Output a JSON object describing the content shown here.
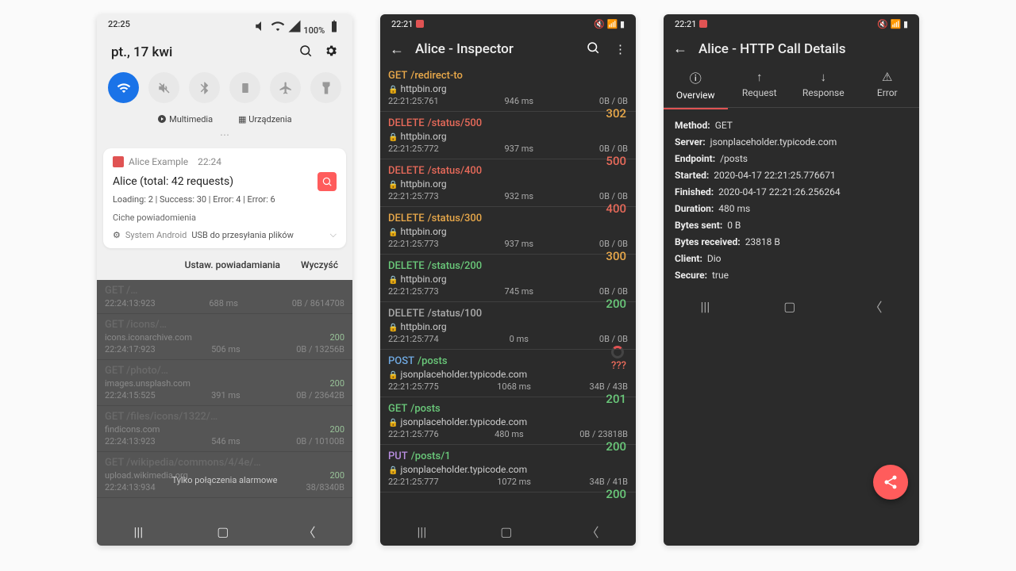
{
  "phone1": {
    "status": {
      "time": "22:25",
      "right": "100%"
    },
    "date": "pt., 17 kwi",
    "media": "Multimedia",
    "devices": "Urządzenia",
    "notif": {
      "app": "Alice Example",
      "time": "22:24",
      "title": "Alice (total: 42 requests)",
      "sub": "Loading: 2 | Success: 30 | Error: 4 | Error: 6"
    },
    "quiet": "Ciche powiadomienia",
    "system": {
      "label": "System Android",
      "text": "USB do przesyłania plików"
    },
    "actions": {
      "settings": "Ustaw. powiadamiania",
      "clear": "Wyczyść"
    },
    "dim": {
      "overlay": "Tylko połączenia alarmowe"
    }
  },
  "phone2": {
    "status": {
      "time": "22:21"
    },
    "title": "Alice - Inspector",
    "requests": [
      {
        "method": "GET",
        "path": "/redirect-to",
        "host": "httpbin.org",
        "ts": "22:21:25:761",
        "dur": "946 ms",
        "size": "0B / 0B",
        "code": "302",
        "cls": "c-orange"
      },
      {
        "method": "DELETE",
        "path": "/status/500",
        "host": "httpbin.org",
        "ts": "22:21:25:772",
        "dur": "937 ms",
        "size": "0B / 0B",
        "code": "500",
        "cls": "c-red"
      },
      {
        "method": "DELETE",
        "path": "/status/400",
        "host": "httpbin.org",
        "ts": "22:21:25:773",
        "dur": "932 ms",
        "size": "0B / 0B",
        "code": "400",
        "cls": "c-red"
      },
      {
        "method": "DELETE",
        "path": "/status/300",
        "host": "httpbin.org",
        "ts": "22:21:25:773",
        "dur": "937 ms",
        "size": "0B / 0B",
        "code": "300",
        "cls": "c-orange"
      },
      {
        "method": "DELETE",
        "path": "/status/200",
        "host": "httpbin.org",
        "ts": "22:21:25:773",
        "dur": "745 ms",
        "size": "0B / 0B",
        "code": "200",
        "cls": "c-green"
      },
      {
        "method": "DELETE",
        "path": "/status/100",
        "host": "httpbin.org",
        "ts": "22:21:25:774",
        "dur": "0 ms",
        "size": "0B / 0B",
        "code": "???",
        "cls": "c-default",
        "loading": true
      },
      {
        "method": "POST",
        "path": "/posts",
        "host": "jsonplaceholder.typicode.com",
        "ts": "22:21:25:775",
        "dur": "1068 ms",
        "size": "34B / 43B",
        "code": "201",
        "cls": "c-green",
        "mcls": "c-blue"
      },
      {
        "method": "GET",
        "path": "/posts",
        "host": "jsonplaceholder.typicode.com",
        "ts": "22:21:25:776",
        "dur": "480 ms",
        "size": "0B / 23818B",
        "code": "200",
        "cls": "c-green"
      },
      {
        "method": "PUT",
        "path": "/posts/1",
        "host": "jsonplaceholder.typicode.com",
        "ts": "22:21:25:777",
        "dur": "1072 ms",
        "size": "34B / 41B",
        "code": "200",
        "cls": "c-green",
        "mcls": "c-purple"
      }
    ]
  },
  "phone3": {
    "status": {
      "time": "22:21"
    },
    "title": "Alice - HTTP Call Details",
    "tabs": [
      "Overview",
      "Request",
      "Response",
      "Error"
    ],
    "details": [
      {
        "k": "Method:",
        "v": "GET"
      },
      {
        "k": "Server:",
        "v": "jsonplaceholder.typicode.com"
      },
      {
        "k": "Endpoint:",
        "v": "/posts"
      },
      {
        "k": "Started:",
        "v": "2020-04-17 22:21:25.776671"
      },
      {
        "k": "Finished:",
        "v": "2020-04-17 22:21:26.256264"
      },
      {
        "k": "Duration:",
        "v": "480 ms"
      },
      {
        "k": "Bytes sent:",
        "v": "0 B"
      },
      {
        "k": "Bytes received:",
        "v": "23818 B"
      },
      {
        "k": "Client:",
        "v": "Dio"
      },
      {
        "k": "Secure:",
        "v": "true"
      }
    ]
  }
}
